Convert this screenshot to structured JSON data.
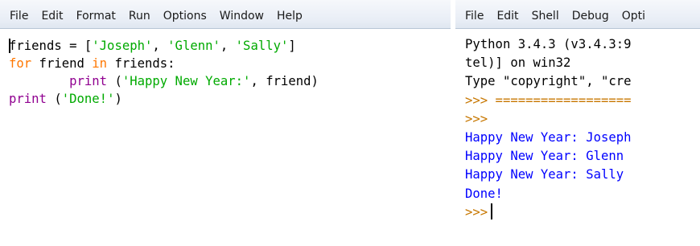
{
  "colors": {
    "keyword": "#ff7700",
    "string": "#00aa00",
    "builtin": "#900090",
    "default": "#000000",
    "output": "#0000ff",
    "prompt": "#c77700"
  },
  "editor": {
    "menu": [
      "File",
      "Edit",
      "Format",
      "Run",
      "Options",
      "Window",
      "Help"
    ],
    "lines": [
      [
        {
          "text": "friends = [",
          "kind": "default"
        },
        {
          "text": "'Joseph'",
          "kind": "string"
        },
        {
          "text": ", ",
          "kind": "default"
        },
        {
          "text": "'Glenn'",
          "kind": "string"
        },
        {
          "text": ", ",
          "kind": "default"
        },
        {
          "text": "'Sally'",
          "kind": "string"
        },
        {
          "text": "]",
          "kind": "default"
        }
      ],
      [
        {
          "text": "for",
          "kind": "keyword"
        },
        {
          "text": " friend ",
          "kind": "default"
        },
        {
          "text": "in",
          "kind": "keyword"
        },
        {
          "text": " friends:",
          "kind": "default"
        }
      ],
      [
        {
          "text": "        ",
          "kind": "default"
        },
        {
          "text": "print",
          "kind": "builtin"
        },
        {
          "text": " (",
          "kind": "default"
        },
        {
          "text": "'Happy New Year:'",
          "kind": "string"
        },
        {
          "text": ", friend)",
          "kind": "default"
        }
      ],
      [
        {
          "text": "print",
          "kind": "builtin"
        },
        {
          "text": " (",
          "kind": "default"
        },
        {
          "text": "'Done!'",
          "kind": "string"
        },
        {
          "text": ")",
          "kind": "default"
        }
      ]
    ]
  },
  "shell": {
    "menu": [
      "File",
      "Edit",
      "Shell",
      "Debug",
      "Opti"
    ],
    "lines": [
      {
        "text": "Python 3.4.3 (v3.4.3:9",
        "kind": "default"
      },
      {
        "text": "tel)] on win32",
        "kind": "default"
      },
      {
        "text": "Type \"copyright\", \"cre",
        "kind": "default"
      },
      {
        "text": ">>> ==================",
        "kind": "prompt"
      },
      {
        "text": ">>>",
        "kind": "prompt"
      },
      {
        "text": "Happy New Year: Joseph",
        "kind": "output"
      },
      {
        "text": "Happy New Year: Glenn",
        "kind": "output"
      },
      {
        "text": "Happy New Year: Sally",
        "kind": "output"
      },
      {
        "text": "Done!",
        "kind": "output"
      },
      {
        "text": ">>>",
        "kind": "prompt"
      }
    ]
  }
}
